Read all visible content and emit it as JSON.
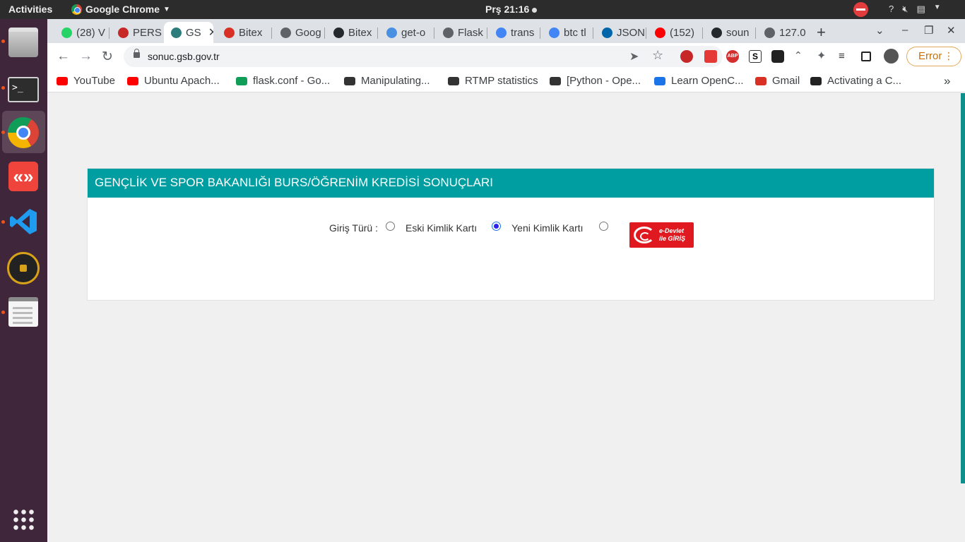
{
  "topbar": {
    "activities": "Activities",
    "app_name": "Google Chrome",
    "clock": "Prş 21:16",
    "help": "?"
  },
  "tabs": [
    {
      "title": "(28) V",
      "favicon": "whatsapp-icon",
      "color": "#25d366"
    },
    {
      "title": "PERS",
      "favicon": "gov-seal-icon",
      "color": "#c62828"
    },
    {
      "title": "GS",
      "favicon": "gsb-logo-icon",
      "color": "#2e7d7d",
      "active": true
    },
    {
      "title": "Bitex",
      "favicon": "gmail-icon",
      "color": "#d93025"
    },
    {
      "title": "Goog",
      "favicon": "globe-icon",
      "color": "#5f6368"
    },
    {
      "title": "Bitex",
      "favicon": "github-icon",
      "color": "#24292e"
    },
    {
      "title": "get-o",
      "favicon": "vscode-dev-icon",
      "color": "#4a90e2"
    },
    {
      "title": "Flask",
      "favicon": "globe-icon",
      "color": "#5f6368"
    },
    {
      "title": "trans",
      "favicon": "google-icon",
      "color": "#4285f4"
    },
    {
      "title": "btc tl",
      "favicon": "google-icon",
      "color": "#4285f4"
    },
    {
      "title": "JSON",
      "favicon": "vscode-icon",
      "color": "#0065a9"
    },
    {
      "title": "(152)",
      "favicon": "youtube-icon",
      "color": "#ff0000"
    },
    {
      "title": "soun",
      "favicon": "github-icon",
      "color": "#24292e"
    },
    {
      "title": "127.0",
      "favicon": "globe-icon",
      "color": "#5f6368"
    }
  ],
  "toolbar": {
    "url": "sonuc.gsb.gov.tr",
    "error_label": "Error"
  },
  "bookmarks": [
    {
      "label": "YouTube",
      "icon": "youtube-icon",
      "color": "#ff0000"
    },
    {
      "label": "Ubuntu Apach...",
      "icon": "youtube-icon",
      "color": "#ff0000"
    },
    {
      "label": "flask.conf - Go...",
      "icon": "google-drive-icon",
      "color": "#0f9d58"
    },
    {
      "label": "Manipulating...",
      "icon": "pt-icon",
      "color": "#333"
    },
    {
      "label": "RTMP statistics",
      "icon": "globe-icon",
      "color": "#333"
    },
    {
      "label": "[Python - Ope...",
      "icon": "globe-icon",
      "color": "#333"
    },
    {
      "label": "Learn OpenC...",
      "icon": "opencv-icon",
      "color": "#1a73e8"
    },
    {
      "label": "Gmail",
      "icon": "gmail-icon",
      "color": "#d93025"
    },
    {
      "label": "Activating a C...",
      "icon": "p-icon",
      "color": "#222"
    }
  ],
  "page": {
    "header_title": "GENÇLİK VE SPOR BAKANLIĞI BURS/ÖĞRENİM KREDİSİ SONUÇLARI",
    "login_label": "Giriş Türü :",
    "option_old": "Eski Kimlik Kartı",
    "option_new": "Yeni Kimlik Kartı",
    "selected": "option_new",
    "edevlet_line1": "e-Devlet",
    "edevlet_line2": "ile GİRİŞ"
  }
}
